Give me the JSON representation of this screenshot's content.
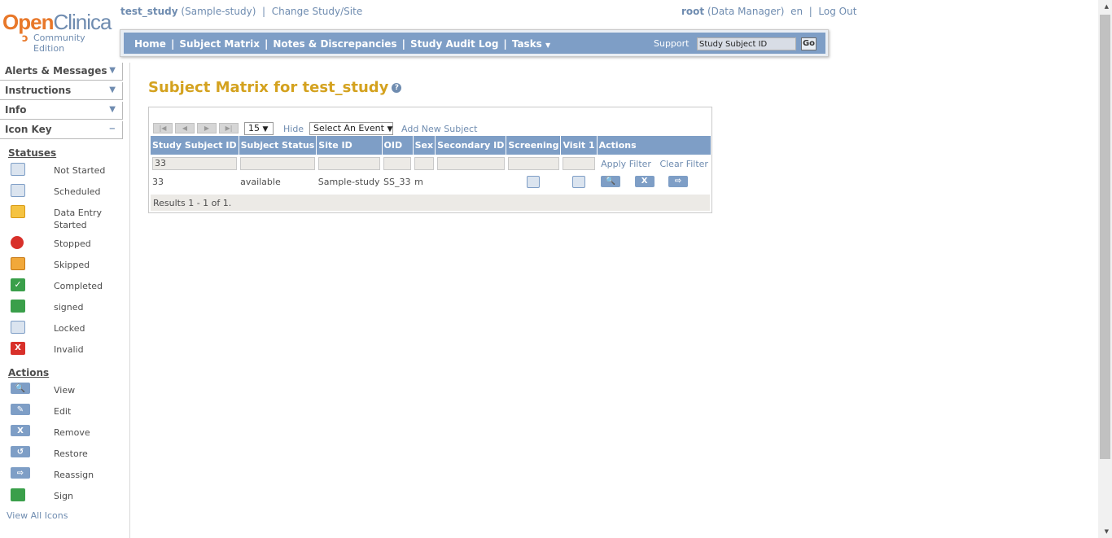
{
  "logo": {
    "brand_open": "Open",
    "brand_clinica": "Clinica",
    "edition": "Community Edition"
  },
  "study": {
    "name": "test_study",
    "site": "(Sample-study)",
    "sep": "|",
    "change_link": "Change Study/Site"
  },
  "user": {
    "name": "root",
    "role": "(Data Manager)",
    "lang": "en",
    "sep": "|",
    "logout": "Log Out"
  },
  "nav": {
    "items": [
      "Home",
      "Subject Matrix",
      "Notes & Discrepancies",
      "Study Audit Log",
      "Tasks"
    ],
    "separator": "|",
    "support": "Support",
    "search_value": "Study Subject ID",
    "go": "Go"
  },
  "sidebar": {
    "panels": [
      {
        "label": "Alerts & Messages",
        "state": "collapsed"
      },
      {
        "label": "Instructions",
        "state": "collapsed"
      },
      {
        "label": "Info",
        "state": "collapsed"
      },
      {
        "label": "Icon Key",
        "state": "expanded"
      }
    ],
    "statuses_heading": "Statuses",
    "statuses": [
      {
        "label": "Not Started",
        "icon": "not-started-icon"
      },
      {
        "label": "Scheduled",
        "icon": "scheduled-icon"
      },
      {
        "label": "Data Entry Started",
        "icon": "data-entry-started-icon"
      },
      {
        "label": "Stopped",
        "icon": "stopped-icon"
      },
      {
        "label": "Skipped",
        "icon": "skipped-icon"
      },
      {
        "label": "Completed",
        "icon": "completed-icon"
      },
      {
        "label": "signed",
        "icon": "signed-icon"
      },
      {
        "label": "Locked",
        "icon": "locked-icon"
      },
      {
        "label": "Invalid",
        "icon": "invalid-icon"
      }
    ],
    "actions_heading": "Actions",
    "actions": [
      {
        "label": "View",
        "icon": "view-icon",
        "glyph": "🔍"
      },
      {
        "label": "Edit",
        "icon": "edit-icon",
        "glyph": "✎"
      },
      {
        "label": "Remove",
        "icon": "remove-icon",
        "glyph": "X"
      },
      {
        "label": "Restore",
        "icon": "restore-icon",
        "glyph": "↺"
      },
      {
        "label": "Reassign",
        "icon": "reassign-icon",
        "glyph": "⇨"
      },
      {
        "label": "Sign",
        "icon": "sign-icon",
        "glyph": "✍"
      }
    ],
    "view_all": "View All Icons"
  },
  "page": {
    "title": "Subject Matrix for test_study",
    "help": "?"
  },
  "toolbar": {
    "page_size": "15",
    "hide": "Hide",
    "event_select": "Select An Event",
    "add_subject": "Add New Subject"
  },
  "table": {
    "columns": [
      "Study Subject ID",
      "Subject Status",
      "Site ID",
      "OID",
      "Sex",
      "Secondary ID",
      "Screening",
      "Visit 1",
      "Actions"
    ],
    "filter_subject_id": "33",
    "apply_filter": "Apply Filter",
    "clear_filter": "Clear Filter",
    "rows": [
      {
        "subject_id": "33",
        "status": "available",
        "site_id": "Sample-study",
        "oid": "SS_33",
        "sex": "m",
        "secondary_id": "",
        "screening": "scheduled-icon",
        "visit1": "not-started-icon",
        "actions": [
          "view-icon",
          "remove-icon",
          "reassign-icon"
        ]
      }
    ],
    "results": "Results 1 - 1 of 1."
  },
  "colors": {
    "nav_blue": "#7e9ec6",
    "title_gold": "#d4a21f",
    "link_blue": "#6f8cb0",
    "logo_orange": "#e8782a"
  }
}
